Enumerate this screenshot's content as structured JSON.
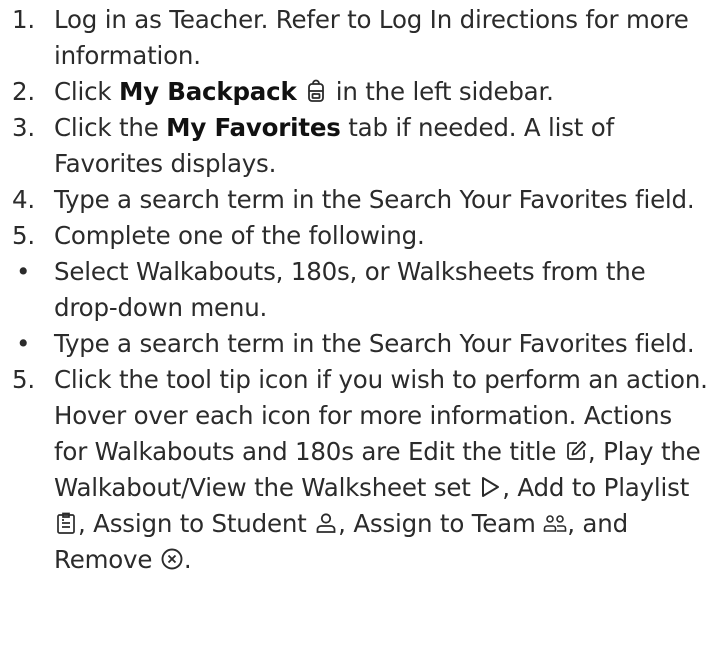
{
  "steps": [
    {
      "n": "1.",
      "text": "Log in as Teacher. Refer to Log In directions for more information."
    },
    {
      "n": "2.",
      "pre": "Click ",
      "bold": "My Backpack",
      "icon": "backpack-icon",
      "post": " in the left sidebar."
    },
    {
      "n": "3.",
      "pre": "Click the ",
      "bold": "My Favorites",
      "post": " tab if needed. A list of Favorites displays."
    },
    {
      "n": "4.",
      "text": "Type a search term in the Search Your Favorites field."
    },
    {
      "n": "5.",
      "text": "Complete one of the following."
    }
  ],
  "bullets": [
    "Select Walkabouts, 180s, or Walksheets from the drop-down menu.",
    "Type a search term in the Search Your Favorites field."
  ],
  "final_step": {
    "n": "5.",
    "line1": "Click the tool tip icon if you wish to perform an action. Hover over each icon for more information. Actions for Walkabouts and 180s are Edit the title",
    "edit_icon": "edit-icon",
    "after_edit": ", Play the Walkabout/View the Walksheet set",
    "play_icon": "play-icon",
    "after_play": ", Add to Playlist",
    "playlist_icon": "playlist-icon",
    "after_playlist": ",  Assign to Student",
    "student_icon": "student-icon",
    "after_student": ", Assign to Team",
    "team_icon": "team-icon",
    "after_team": ", and Remove",
    "remove_icon": "remove-icon",
    "end": "."
  },
  "colors": {
    "text": "#2b2b2b",
    "bold": "#111111"
  }
}
